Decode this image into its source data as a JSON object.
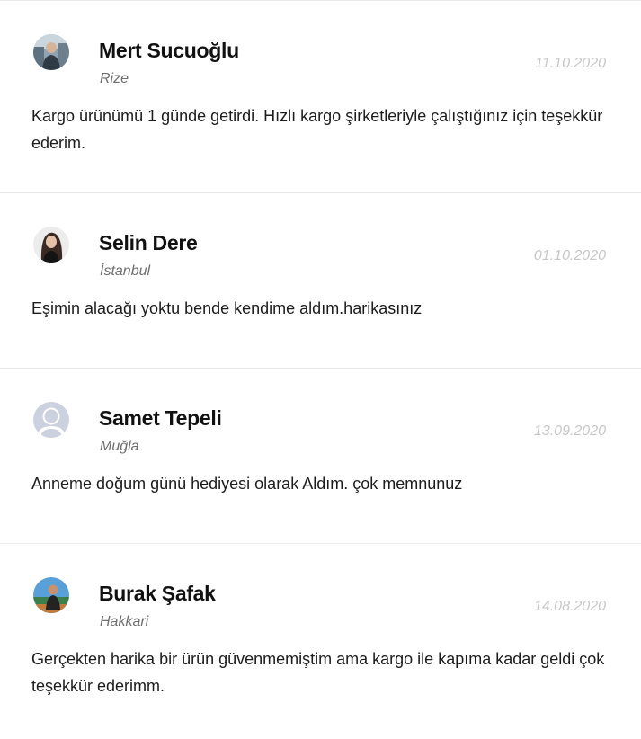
{
  "reviews": [
    {
      "avatar": "user-photo-1",
      "name": "Mert Sucuoğlu",
      "city": "Rize",
      "date": "11.10.2020",
      "text": "Kargo ürünümü 1 günde getirdi. Hızlı kargo şirketleriyle çalıştığınız için teşekkür ederim."
    },
    {
      "avatar": "user-photo-2",
      "name": "Selin Dere",
      "city": "İstanbul",
      "date": "01.10.2020",
      "text": "Eşimin alacağı yoktu bende kendime aldım.harikasınız"
    },
    {
      "avatar": "default-user-icon",
      "name": "Samet Tepeli",
      "city": "Muğla",
      "date": "13.09.2020",
      "text": "Anneme doğum günü hediyesi olarak Aldım. çok memnunuz"
    },
    {
      "avatar": "user-photo-3",
      "name": "Burak Şafak",
      "city": "Hakkari",
      "date": "14.08.2020",
      "text": "Gerçekten harika bir ürün güvenmemiştim ama kargo ile kapıma kadar geldi çok teşekkür ederimm."
    }
  ],
  "colors": {
    "name": "#111111",
    "city": "#6e6e6e",
    "date": "#c7c7c7",
    "divider": "#ececec"
  }
}
